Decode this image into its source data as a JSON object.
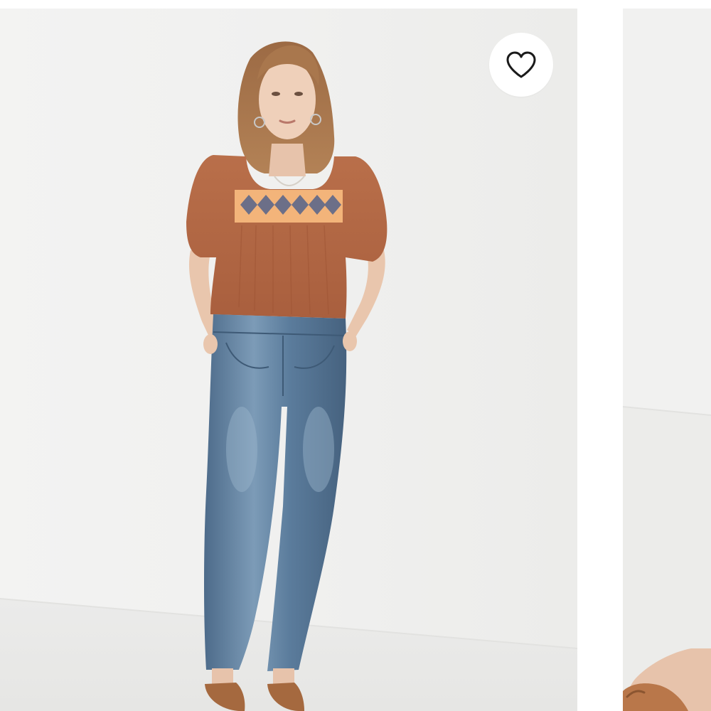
{
  "carousel": {
    "items": [
      {
        "product_photo": "woman-in-rust-square-neck-top-and-blue-jeans",
        "favorite_icon": "heart-outline-icon"
      },
      {
        "product_photo": "partial-next-product-photo",
        "favorite_icon": null
      }
    ]
  },
  "colors": {
    "background": "#ffffff",
    "photo_backdrop": "#f1f1f0",
    "top_rust": "#b86b47",
    "denim": "#5d7f9e",
    "favorite_button_fill": "#ffffff",
    "heart_stroke": "#1a1a1a"
  }
}
